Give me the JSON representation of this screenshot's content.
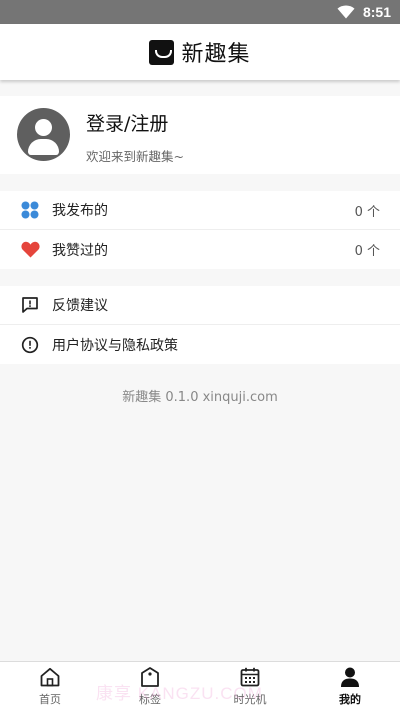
{
  "status_bar": {
    "time": "8:51",
    "icons": [
      "wifi-icon",
      "signal-icon",
      "battery-icon"
    ]
  },
  "header": {
    "title": "新趣集",
    "logo_icon": "inbox-logo-icon"
  },
  "profile": {
    "title": "登录/注册",
    "subtitle": "欢迎来到新趣集~",
    "avatar_icon": "user-avatar-icon"
  },
  "stats": [
    {
      "icon": "grid-dots-icon",
      "label": "我发布的",
      "count": "0 个",
      "icon_color": "#3b8ad9"
    },
    {
      "icon": "heart-icon",
      "label": "我赞过的",
      "count": "0 个",
      "icon_color": "#e5453c"
    }
  ],
  "links": [
    {
      "icon": "feedback-icon",
      "label": "反馈建议"
    },
    {
      "icon": "info-alert-icon",
      "label": "用户协议与隐私政策"
    }
  ],
  "version_text": "新趣集 0.1.0 xinquji.com",
  "tabs": [
    {
      "icon": "home-icon",
      "label": "首页",
      "active": false
    },
    {
      "icon": "tag-icon",
      "label": "标签",
      "active": false
    },
    {
      "icon": "calendar-icon",
      "label": "时光机",
      "active": false
    },
    {
      "icon": "person-icon",
      "label": "我的",
      "active": true
    }
  ],
  "watermark": "康享 KANGZU.COM"
}
